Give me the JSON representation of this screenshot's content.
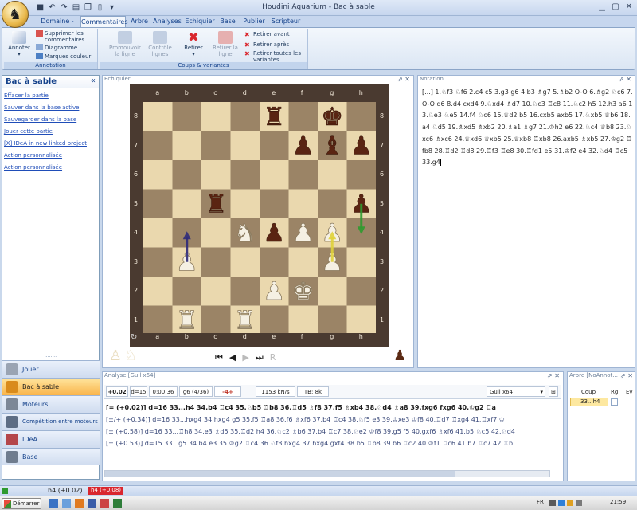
{
  "window": {
    "title": "Houdini Aquarium - Bac à sable",
    "controls": [
      "minimize-icon",
      "maximize-icon",
      "close-icon"
    ]
  },
  "quick_access": [
    "save-icon",
    "undo-icon",
    "redo-icon",
    "print-icon",
    "copy-icon",
    "paste-icon",
    "dropdown-icon"
  ],
  "ribbon": {
    "tabs": [
      "Domaine - Voir",
      "Commentaires",
      "Arbre",
      "Analyses",
      "Echiquier",
      "Base",
      "Publier",
      "Scripteur"
    ],
    "active_tab": "Commentaires",
    "groups": {
      "annotation": {
        "label": "Annotation",
        "annotate_label": "Annoter",
        "delete_comments": "Supprimer les commentaires",
        "diagram": "Diagramme",
        "color_marks": "Marques couleur"
      },
      "moves": {
        "label": "Coups & variantes",
        "promote": "Promouvoir la ligne",
        "control": "Contrôle lignes",
        "remove": "Retirer",
        "remove_line": "Retirer la ligne",
        "remove_before": "Retirer avant",
        "remove_after": "Retirer après",
        "remove_all": "Retirer toutes les variantes"
      }
    }
  },
  "left_panel": {
    "title": "Bac à sable",
    "collapse": "«",
    "links": [
      "Effacer la partie",
      "Sauver dans la base active",
      "Sauvegarder dans la base",
      "Jouer cette partie",
      "[X] IDeA in new linked project",
      "Action personnalisée",
      "Action personnalisée"
    ],
    "splitter": "........",
    "nav": [
      {
        "label": "Jouer",
        "icon": "play-icon"
      },
      {
        "label": "Bac à sable",
        "icon": "sandbox-icon"
      },
      {
        "label": "Moteurs",
        "icon": "engine-icon"
      },
      {
        "label": "Compétition entre moteurs",
        "icon": "competition-icon"
      },
      {
        "label": "IDeA",
        "icon": "idea-icon"
      },
      {
        "label": "Base",
        "icon": "database-icon"
      }
    ]
  },
  "board": {
    "panel_title": "Echiquier",
    "files": [
      "a",
      "b",
      "c",
      "d",
      "e",
      "f",
      "g",
      "h"
    ],
    "ranks": [
      "8",
      "7",
      "6",
      "5",
      "4",
      "3",
      "2",
      "1"
    ],
    "light_square": "#ead8ae",
    "dark_square": "#9b8466",
    "pieces": [
      {
        "sq": "e8",
        "glyph": "♜",
        "side": "black"
      },
      {
        "sq": "g8",
        "glyph": "♚",
        "side": "black"
      },
      {
        "sq": "f7",
        "glyph": "♟",
        "side": "black"
      },
      {
        "sq": "g7",
        "glyph": "♝",
        "side": "black"
      },
      {
        "sq": "h7",
        "glyph": "♟",
        "side": "black"
      },
      {
        "sq": "c5",
        "glyph": "♜",
        "side": "black"
      },
      {
        "sq": "h5",
        "glyph": "♟",
        "side": "black"
      },
      {
        "sq": "e4",
        "glyph": "♟",
        "side": "black"
      },
      {
        "sq": "d4",
        "glyph": "♞",
        "side": "white"
      },
      {
        "sq": "f4",
        "glyph": "♟",
        "side": "white"
      },
      {
        "sq": "g4",
        "glyph": "♟",
        "side": "white"
      },
      {
        "sq": "b3",
        "glyph": "♟",
        "side": "white"
      },
      {
        "sq": "g3",
        "glyph": "♟",
        "side": "white"
      },
      {
        "sq": "e2",
        "glyph": "♟",
        "side": "white"
      },
      {
        "sq": "f2",
        "glyph": "♚",
        "side": "white"
      },
      {
        "sq": "b1",
        "glyph": "♜",
        "side": "white"
      },
      {
        "sq": "d1",
        "glyph": "♜",
        "side": "white"
      }
    ],
    "arrows": [
      {
        "from": "b3",
        "to": "b4",
        "color": "#2e2a7a"
      },
      {
        "from": "h5",
        "to": "h4",
        "color": "#2f9a2f"
      },
      {
        "from": "g3",
        "to": "g4",
        "color": "#e0d23a"
      }
    ],
    "nav_buttons": [
      "first-icon",
      "prev-icon",
      "next-icon",
      "last-icon",
      "redo-icon"
    ]
  },
  "notation": {
    "panel_title": "Notation",
    "text": "[...] 1.♘f3 ♘f6 2.c4 c5 3.g3 g6 4.b3 ♗g7 5.♗b2 O-O 6.♗g2 ♘c6 7.O-O d6 8.d4 cxd4 9.♘xd4 ♗d7 10.♘c3 ♖c8 11.♘c2 h5 12.h3 a6 13.♘e3 ♘e5 14.f4 ♘c6 15.♕d2 b5 16.cxb5 axb5 17.♘xb5 ♕b6 18.a4 ♘d5 19.♗xd5 ♗xb2 20.♗a1 ♗g7 21.♔h2 e6 22.♘c4 ♕b8 23.♘xc6 ♗xc6 24.♕xd6 ♕xb5 25.♕xb8 ♖xb8 26.axb5 ♗xb5 27.♔g2 ♖fb8 28.♖d2 ♖d8 29.♖f3 ♖e8 30.♖fd1 e5 31.♔f2 e4 32.♘d4 ♖c5 33.g4"
  },
  "analysis": {
    "panel_title": "Analyse [Gull x64]",
    "score": "+0.02",
    "depth": "d=15",
    "time": "0:00:36",
    "move": "g6 (4/36)",
    "buttons": "-4+",
    "speed": "1153 kN/s",
    "tb": "TB: 8k",
    "engine": "Gull x64",
    "lines": [
      "[= (+0.02)] d=16  33...h4 34.b4 ♖c4 35.♘b5 ♖b8 36.♖d5 ♗f8 37.f5 ♗xb4 38.♘d4 ♗a8 39.fxg6 fxg6 40.♔g2 ♖a",
      "[±/+ (+0.34)] d=16  33...hxg4 34.hxg4 g5 35.f5 ♖a8 36.f6 ♗xf6 37.b4 ♖c4 38.♘f5 e3 39.♔xe3 ♔f8 40.♖d7 ♖xg4 41.♖xf7 ♔",
      "[± (+0.58)] d=16  33...♖h8 34.e3 ♗d5 35.♖d2 h4 36.♘c2 ♗b6 37.b4 ♖c7 38.♘e2 ♔f8 39.g5 f5 40.gxf6 ♗xf6 41.b5 ♘c5 42.♘d4",
      "[± (+0.53)] d=15  33...g5 34.b4 e3 35.♔g2 ♖c4 36.♘f3 hxg4 37.hxg4 gxf4 38.b5 ♖b8 39.b6 ♖c2 40.♔f1 ♖c6 41.b7 ♖c7 42.♖b"
    ]
  },
  "tree": {
    "panel_title": "Arbre [NoAnnot...",
    "headers": [
      "Coup",
      "Rg.",
      "Ev"
    ],
    "row": "33...h4"
  },
  "status": {
    "left": "h4 (+0.02)",
    "right": "h4 (+0.08)"
  },
  "taskbar": {
    "start": "Démarrer",
    "lang": "FR",
    "clock": "21:59"
  }
}
